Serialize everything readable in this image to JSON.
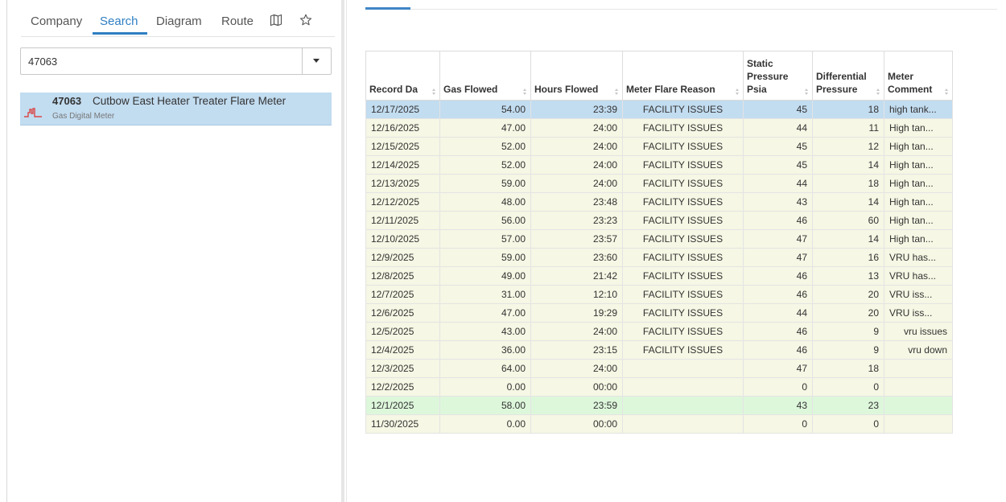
{
  "nav": {
    "tabs": [
      {
        "label": "Company"
      },
      {
        "label": "Search"
      },
      {
        "label": "Diagram"
      },
      {
        "label": "Route"
      }
    ],
    "map_icon": "map-icon",
    "star_icon": "star-icon"
  },
  "search": {
    "value": "47063",
    "placeholder": ""
  },
  "result": {
    "id": "47063",
    "name": "Cutbow East Heater Treater Flare Meter",
    "type": "Gas Digital Meter",
    "icon": "meter-chart-icon"
  },
  "colors": {
    "accent": "#2f7fc2",
    "selected_row": "#c2dcf0",
    "row_bg": "#f6f7e4",
    "green_row": "#ddf7db",
    "meter_icon": "#d94848"
  },
  "table": {
    "headers": [
      {
        "label": "Record Da"
      },
      {
        "label": "Gas Flowed"
      },
      {
        "label": "Hours Flowed"
      },
      {
        "label": "Meter Flare Reason"
      },
      {
        "label": "Static Pressure Psia"
      },
      {
        "label": "Differential Pressure"
      },
      {
        "label": "Meter Comment"
      }
    ],
    "rows": [
      {
        "date": "12/17/2025",
        "gas": "54.00",
        "hours": "23:39",
        "reason": "FACILITY ISSUES",
        "static": "45",
        "diff": "18",
        "comment": "high tank..."
      },
      {
        "date": "12/16/2025",
        "gas": "47.00",
        "hours": "24:00",
        "reason": "FACILITY ISSUES",
        "static": "44",
        "diff": "11",
        "comment": "High tan..."
      },
      {
        "date": "12/15/2025",
        "gas": "52.00",
        "hours": "24:00",
        "reason": "FACILITY ISSUES",
        "static": "45",
        "diff": "12",
        "comment": "High tan..."
      },
      {
        "date": "12/14/2025",
        "gas": "52.00",
        "hours": "24:00",
        "reason": "FACILITY ISSUES",
        "static": "45",
        "diff": "14",
        "comment": "High tan..."
      },
      {
        "date": "12/13/2025",
        "gas": "59.00",
        "hours": "24:00",
        "reason": "FACILITY ISSUES",
        "static": "44",
        "diff": "18",
        "comment": "High tan..."
      },
      {
        "date": "12/12/2025",
        "gas": "48.00",
        "hours": "23:48",
        "reason": "FACILITY ISSUES",
        "static": "43",
        "diff": "14",
        "comment": "High tan..."
      },
      {
        "date": "12/11/2025",
        "gas": "56.00",
        "hours": "23:23",
        "reason": "FACILITY ISSUES",
        "static": "46",
        "diff": "60",
        "comment": "High tan..."
      },
      {
        "date": "12/10/2025",
        "gas": "57.00",
        "hours": "23:57",
        "reason": "FACILITY ISSUES",
        "static": "47",
        "diff": "14",
        "comment": "High tan..."
      },
      {
        "date": "12/9/2025",
        "gas": "59.00",
        "hours": "23:60",
        "reason": "FACILITY ISSUES",
        "static": "47",
        "diff": "16",
        "comment": "VRU has..."
      },
      {
        "date": "12/8/2025",
        "gas": "49.00",
        "hours": "21:42",
        "reason": "FACILITY ISSUES",
        "static": "46",
        "diff": "13",
        "comment": "VRU has..."
      },
      {
        "date": "12/7/2025",
        "gas": "31.00",
        "hours": "12:10",
        "reason": "FACILITY ISSUES",
        "static": "46",
        "diff": "20",
        "comment": "VRU iss..."
      },
      {
        "date": "12/6/2025",
        "gas": "47.00",
        "hours": "19:29",
        "reason": "FACILITY ISSUES",
        "static": "44",
        "diff": "20",
        "comment": "VRU iss..."
      },
      {
        "date": "12/5/2025",
        "gas": "43.00",
        "hours": "24:00",
        "reason": "FACILITY ISSUES",
        "static": "46",
        "diff": "9",
        "comment": "vru issues"
      },
      {
        "date": "12/4/2025",
        "gas": "36.00",
        "hours": "23:15",
        "reason": "FACILITY ISSUES",
        "static": "46",
        "diff": "9",
        "comment": "vru down"
      },
      {
        "date": "12/3/2025",
        "gas": "64.00",
        "hours": "24:00",
        "reason": "",
        "static": "47",
        "diff": "18",
        "comment": ""
      },
      {
        "date": "12/2/2025",
        "gas": "0.00",
        "hours": "00:00",
        "reason": "",
        "static": "0",
        "diff": "0",
        "comment": ""
      },
      {
        "date": "12/1/2025",
        "gas": "58.00",
        "hours": "23:59",
        "reason": "",
        "static": "43",
        "diff": "23",
        "comment": ""
      },
      {
        "date": "11/30/2025",
        "gas": "0.00",
        "hours": "00:00",
        "reason": "",
        "static": "0",
        "diff": "0",
        "comment": ""
      }
    ]
  }
}
